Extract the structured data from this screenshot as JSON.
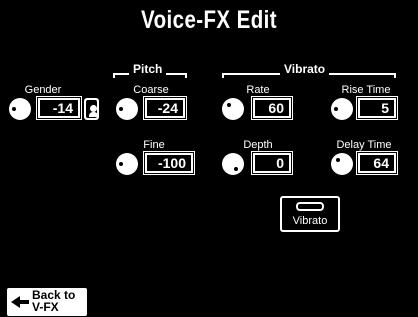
{
  "screen": {
    "title": "Voice-FX Edit"
  },
  "groups": {
    "pitch": "Pitch",
    "vibrato": "Vibrato"
  },
  "params": {
    "gender": {
      "label": "Gender",
      "value": "-14"
    },
    "coarse": {
      "label": "Coarse",
      "value": "-24"
    },
    "fine": {
      "label": "Fine",
      "value": "-100"
    },
    "rate": {
      "label": "Rate",
      "value": "60"
    },
    "depth": {
      "label": "Depth",
      "value": "0"
    },
    "rise_time": {
      "label": "Rise Time",
      "value": "5"
    },
    "delay_time": {
      "label": "Delay Time",
      "value": "64"
    }
  },
  "buttons": {
    "vibrato": "Vibrato",
    "back_line1": "Back to",
    "back_line2": "V-FX"
  },
  "icons": {
    "gender": "gender-face-icon",
    "knob": "knob-icon",
    "back_arrow": "left-arrow-icon"
  },
  "colors": {
    "background": "#000000",
    "foreground": "#ffffff"
  }
}
